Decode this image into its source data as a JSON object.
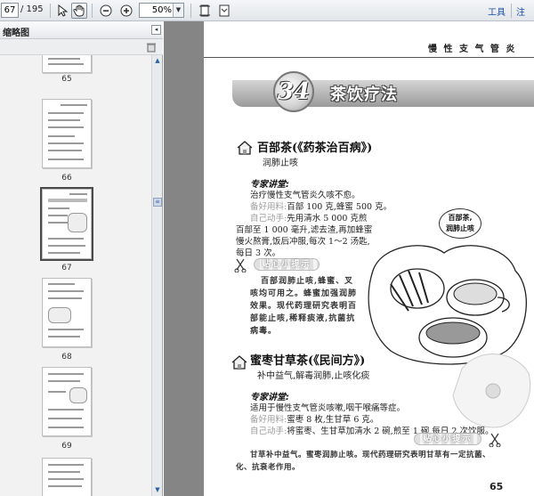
{
  "toolbar": {
    "page_current": "67",
    "page_total": "/ 195",
    "zoom": "50%",
    "tools_label": "工具",
    "annotate_label": "注"
  },
  "sidebar": {
    "title": "缩略图",
    "thumbnails": [
      {
        "label": "65"
      },
      {
        "label": "66"
      },
      {
        "label": "67",
        "selected": true
      },
      {
        "label": "68"
      },
      {
        "label": "69"
      }
    ]
  },
  "page": {
    "header": "慢 性 支 气 管 炎",
    "chapter_number": "34",
    "chapter_title": "茶饮疗法",
    "recipes": [
      {
        "name": "百部茶(《药茶治百病》)",
        "effect": "润肺止咳",
        "expert_label": "专家讲堂:",
        "lines": [
          {
            "tag": "",
            "text": "治疗慢性支气管炎久咳不愈。"
          },
          {
            "tag": "备好用料:",
            "text": "百部 100 克,蜂蜜 500 克。"
          },
          {
            "tag": "自己动手:",
            "text": "先用清水 5 000 克煎"
          },
          {
            "tag": "",
            "text": "百部至 1 000 毫升,滤去渣,再加蜂蜜"
          },
          {
            "tag": "",
            "text": "慢火熬膏,饭后冲服,每次 1～2 汤匙,"
          },
          {
            "tag": "",
            "text": "每日 3 次。"
          }
        ],
        "reminder_title": "贴心小提示",
        "notes": [
          "百部润肺止咳,蜂蜜、叉",
          "咳均可用之。蜂蜜加强润肺",
          "效果。现代药理研究表明百",
          "部能止咳,稀释痰液,抗菌抗",
          "病毒。"
        ],
        "bubble_text": [
          "百部茶,",
          "润肺止咳"
        ]
      },
      {
        "name": "蜜枣甘草茶(《民间方》)",
        "effect": "补中益气,解毒润肺,止咳化痰",
        "expert_label": "专家讲堂:",
        "lines": [
          {
            "tag": "",
            "text": "适用于慢性支气管炎咳嗽,咽干喉痛等症。"
          },
          {
            "tag": "备好用料:",
            "text": "蜜枣 8 枚,生甘草 6 克。"
          },
          {
            "tag": "自己动手:",
            "text": "将蜜枣、生甘草加清水 2 碗,煎至 1 碗,每日 2 次饮服。"
          }
        ],
        "reminder_title": "贴心小提示",
        "notes": [
          "甘草补中益气。蜜枣润肺止咳。现代药理研究表明甘草有一定抗菌、",
          "化、抗衰老作用。"
        ]
      }
    ],
    "page_number": "65"
  }
}
